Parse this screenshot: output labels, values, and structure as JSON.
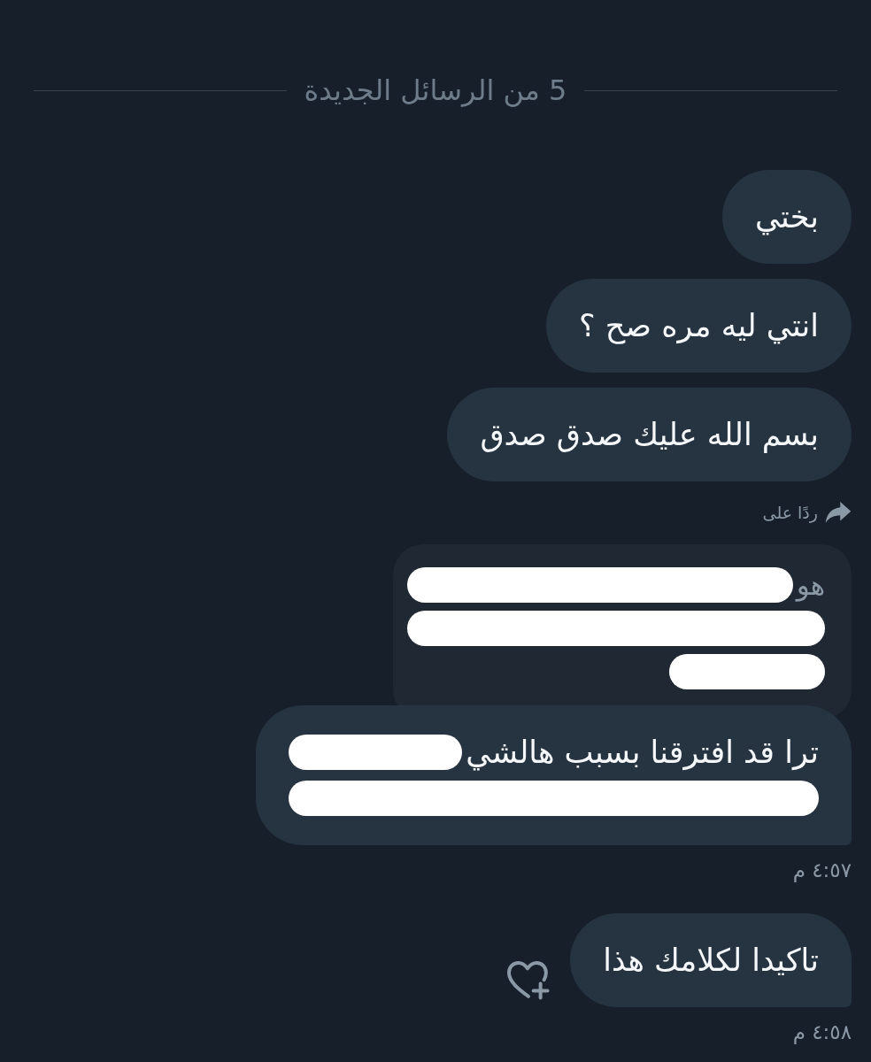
{
  "divider": {
    "label": "5 من الرسائل الجديدة"
  },
  "groups": [
    {
      "messages": [
        {
          "text": "بختي"
        },
        {
          "text": "انتي ليه مره صح ؟"
        },
        {
          "text": "بسم الله عليك صدق صدق"
        },
        {
          "reply_to": {
            "label": "ردًا على",
            "lines": [
              {
                "kind": "partial",
                "text": "هو"
              },
              {
                "kind": "hidden"
              },
              {
                "kind": "stub"
              }
            ]
          },
          "lines": [
            {
              "kind": "partial",
              "text": "ترا قد افترقنا بسبب هالشي"
            },
            {
              "kind": "hidden"
            }
          ]
        }
      ],
      "time": "٤:٥٧ م"
    },
    {
      "messages": [
        {
          "text": "تاكيدا لكلامك هذا",
          "reaction_button": true
        }
      ],
      "time": "٤:٥٨ م"
    }
  ]
}
